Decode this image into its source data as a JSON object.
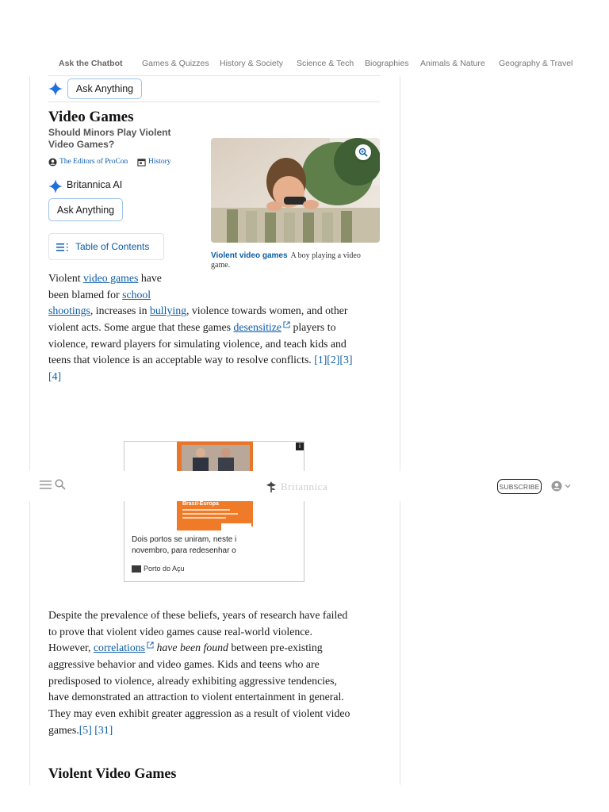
{
  "nav": {
    "items": [
      "Ask the Chatbot",
      "Games & Quizzes",
      "History & Society",
      "Science & Tech",
      "Biographies",
      "Animals & Nature",
      "Geography & Travel"
    ]
  },
  "ask_bar": {
    "button": "Ask Anything"
  },
  "article": {
    "title": "Video Games",
    "subtitle": "Should Minors Play Violent Video Games?",
    "author": "The Editors of ProCon",
    "category": "History",
    "ai_label": "Britannica AI",
    "ai_button": "Ask Anything",
    "toc_label": "Table of Contents",
    "image": {
      "caption_title": "Violent video games",
      "caption_text": "A boy playing a video game."
    },
    "p1": {
      "l1_a": "Violent ",
      "l1_link": "video games",
      "l1_b": " have",
      "l2_a": "been blamed for ",
      "l2_link": "school",
      "l3_link1": "shootings",
      "l3_a": ", increases in ",
      "l3_link2": "bullying",
      "l3_b": ", violence towards women, and other",
      "l4_a": "violent acts. Some argue that these games ",
      "l4_link": "desensitize",
      "l4_b": " players to",
      "l5": "violence, reward players for simulating violence, and teach kids and",
      "l6_a": "teens that violence is an acceptable way to resolve conflicts. ",
      "l6_refs": "[1][2][3]",
      "l7_refs": "[4]"
    },
    "p2": {
      "l1": "Despite the prevalence of these beliefs, years of research have failed",
      "l2": "to prove that violent video games cause real-world violence.",
      "l3_a": "However, ",
      "l3_link": "correlations",
      "l3_em": "have been found",
      "l3_b": " between pre-existing",
      "l4": "aggressive behavior and video games. Kids and teens who are",
      "l5": "predisposed to violence, already exhibiting aggressive tendencies,",
      "l6": "have demonstrated an attraction to violent entertainment in general.",
      "l7": "They may even exhibit greater aggression as a result of violent video",
      "l8_a": "games.",
      "l8_ref1": "[5]",
      "l8_ref2": "[31]"
    },
    "section_heading": "Violent Video Games"
  },
  "ad": {
    "headline_line1": "Dois portos se uniram, neste i",
    "headline_line2": "novembro, para redesenhar o",
    "source": "Porto do Açu",
    "banner_text": "Brasil-Europa",
    "info_badge": "i"
  },
  "sticky_header": {
    "subscribe": "SUBSCRIBE",
    "logo": "Britannica"
  },
  "colors": {
    "link": "#0b5ca8",
    "accent_blue": "#1f6fe0",
    "pill_border": "#9cc3ea"
  }
}
